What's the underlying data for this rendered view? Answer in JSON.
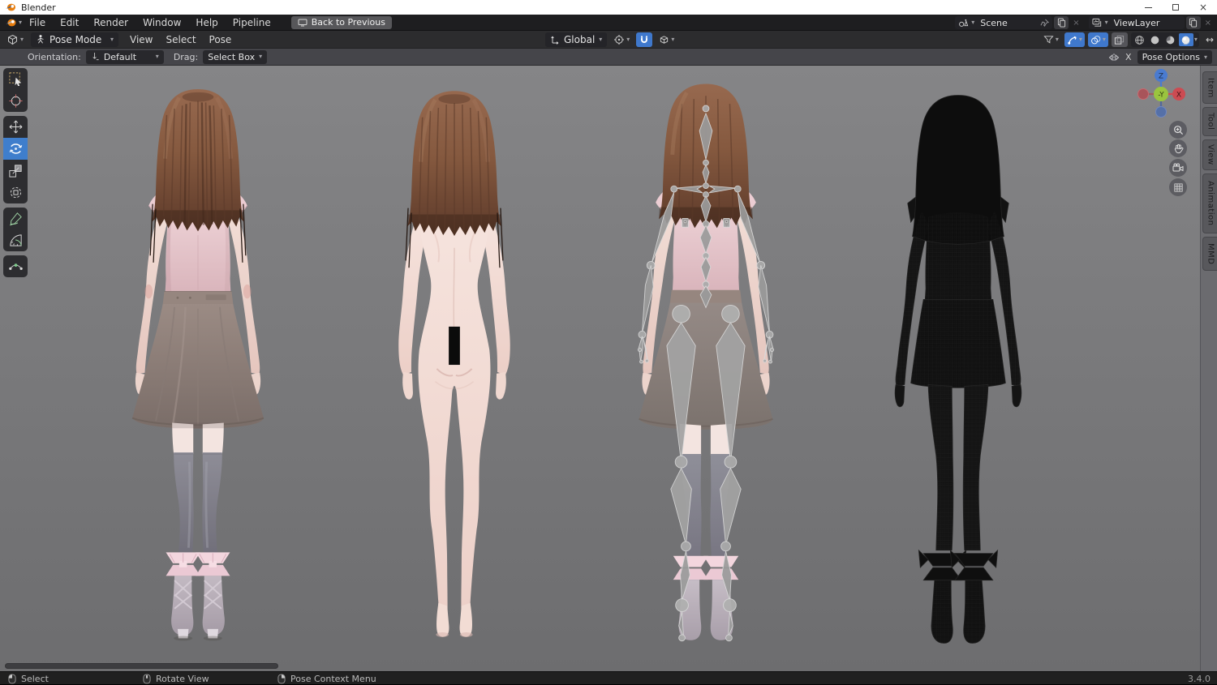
{
  "titlebar": {
    "app_name": "Blender"
  },
  "icons": {
    "chevron": "▾",
    "close": "×",
    "expand_h": "↔"
  },
  "menubar": {
    "items": [
      {
        "label": "File"
      },
      {
        "label": "Edit"
      },
      {
        "label": "Render"
      },
      {
        "label": "Window"
      },
      {
        "label": "Help"
      },
      {
        "label": "Pipeline"
      }
    ],
    "back_button_label": "Back to Previous",
    "scene_field": {
      "value": "Scene"
    },
    "viewlayer_field": {
      "value": "ViewLayer"
    }
  },
  "viewport_header": {
    "mode_value": "Pose Mode",
    "menus": [
      {
        "label": "View"
      },
      {
        "label": "Select"
      },
      {
        "label": "Pose"
      }
    ],
    "orientation_value": "Global"
  },
  "tool_settings": {
    "orientation_label": "Orientation:",
    "orientation_value": "Default",
    "drag_label": "Drag:",
    "drag_value": "Select Box",
    "mirror_x": "X",
    "pose_options": "Pose Options"
  },
  "left_toolbar": {
    "active_tool": "rotate",
    "tools": [
      "box-select",
      "cursor",
      "move",
      "rotate",
      "scale",
      "transform",
      "annotate",
      "measure",
      "pose-breakdowner"
    ]
  },
  "viewport": {
    "models": [
      "textured character back view",
      "base body back view",
      "character with armature back view",
      "wireframe character back view"
    ],
    "gizmo": {
      "top": "Z",
      "right": "X",
      "front": "-Y"
    }
  },
  "sidebar_tabs": [
    {
      "label": "Item"
    },
    {
      "label": "Tool"
    },
    {
      "label": "View"
    },
    {
      "label": "Animation"
    },
    {
      "label": "MMD"
    }
  ],
  "statusbar": {
    "hints": [
      {
        "label": "Select"
      },
      {
        "label": "Rotate View"
      },
      {
        "label": "Pose Context Menu"
      }
    ],
    "version": "3.4.0"
  },
  "colors": {
    "accent_blue": "#3f78cc",
    "viewport_top": "#858587",
    "viewport_bottom": "#6d6d6f"
  }
}
